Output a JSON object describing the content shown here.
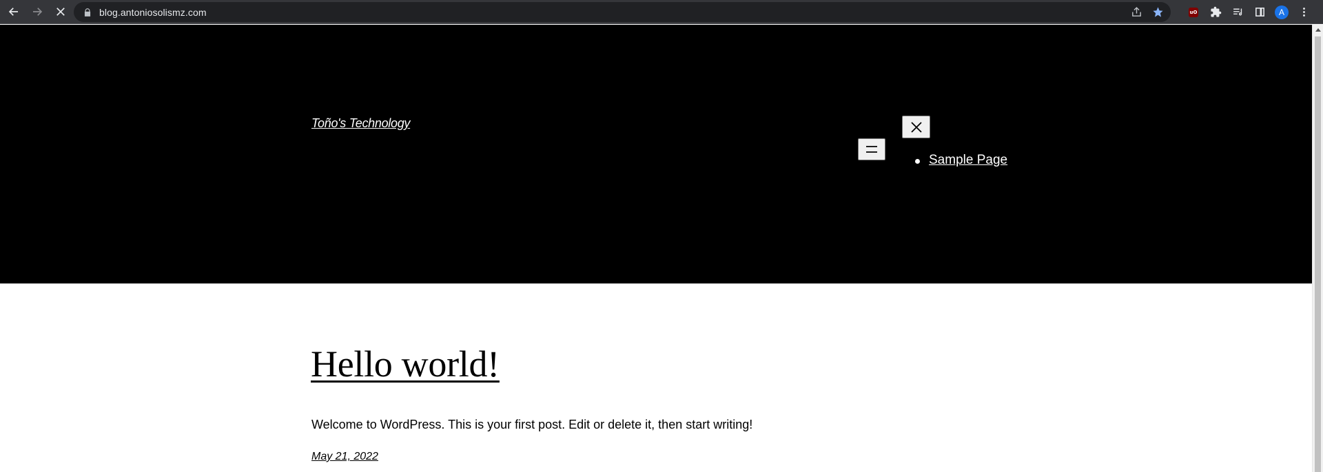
{
  "browser": {
    "url": "blog.antoniosolismz.com",
    "avatar_letter": "A",
    "ublock_label": "uO",
    "icons": {
      "back": "arrow-left-icon",
      "forward": "arrow-right-icon",
      "stop": "close-icon",
      "lock": "lock-icon",
      "share": "share-icon",
      "bookmark": "star-icon",
      "extensions": "puzzle-icon",
      "reading_list": "reading-list-icon",
      "side_panel": "side-panel-icon",
      "menu": "kebab-menu-icon"
    },
    "colors": {
      "bookmark_star": "#8ab4f8",
      "avatar": "#1a73e8",
      "ublock": "#800000"
    }
  },
  "header": {
    "site_title": "Toño's Technology",
    "menu": {
      "open_icon": "hamburger-icon",
      "close_icon": "close-icon",
      "items": [
        {
          "label": "Sample Page"
        }
      ]
    },
    "background": "#000000"
  },
  "post": {
    "title": "Hello world!",
    "excerpt": "Welcome to WordPress. This is your first post. Edit or delete it, then start writing!",
    "date": "May 21, 2022"
  }
}
